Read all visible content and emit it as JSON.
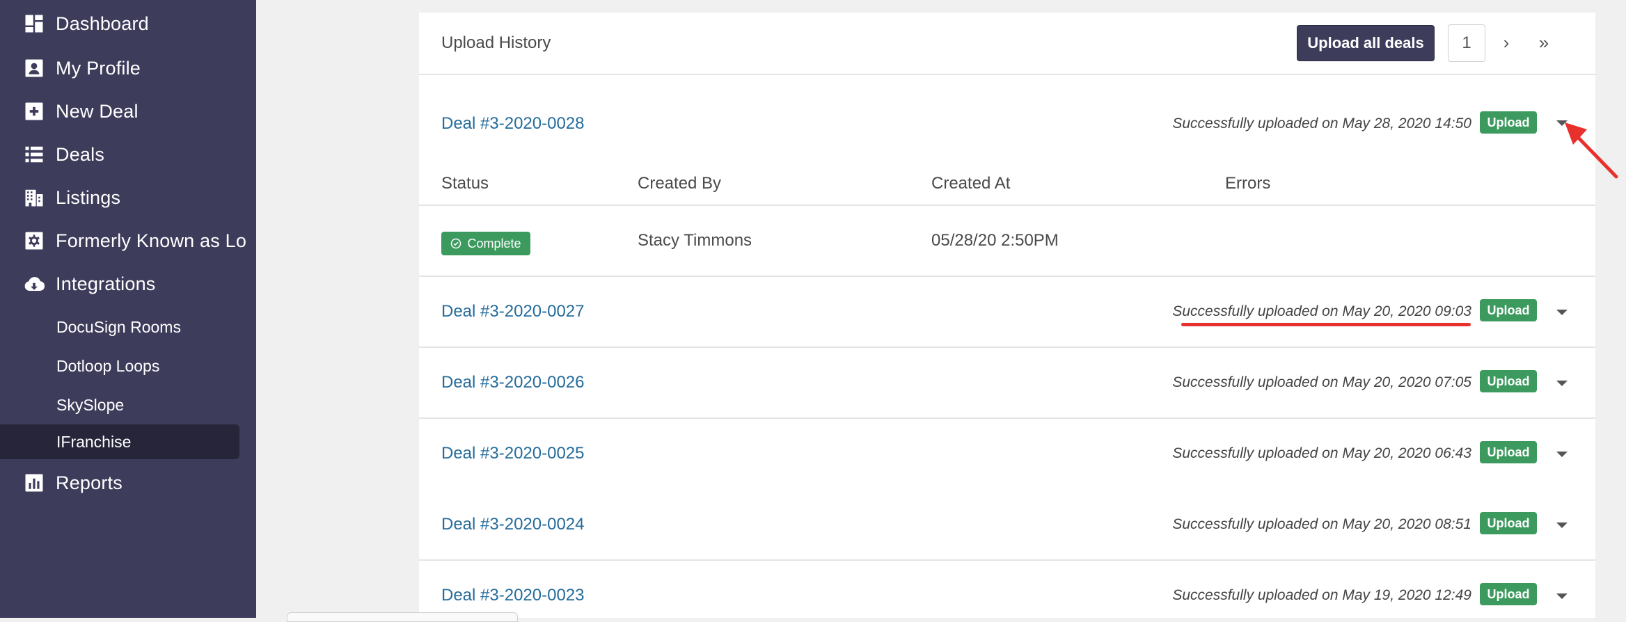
{
  "sidebar": {
    "items": [
      {
        "label": "Dashboard",
        "icon": "dashboard-icon"
      },
      {
        "label": "My Profile",
        "icon": "profile-icon"
      },
      {
        "label": "New Deal",
        "icon": "plus-square-icon"
      },
      {
        "label": "Deals",
        "icon": "list-icon"
      },
      {
        "label": "Listings",
        "icon": "building-icon"
      },
      {
        "label": "Formerly Known as Lo",
        "icon": "gear-icon"
      },
      {
        "label": "Integrations",
        "icon": "cloud-download-icon"
      },
      {
        "label": "Reports",
        "icon": "bar-chart-icon"
      }
    ],
    "integrations": [
      {
        "label": "DocuSign Rooms"
      },
      {
        "label": "Dotloop Loops"
      },
      {
        "label": "SkySlope"
      },
      {
        "label": "IFranchise",
        "active": true
      }
    ]
  },
  "header": {
    "title": "Upload History",
    "upload_all_label": "Upload all deals",
    "page": "1",
    "next": "›",
    "last": "»"
  },
  "deals": [
    {
      "name": "Deal #3-2020-0028",
      "status": "Successfully uploaded on May 28, 2020 14:50",
      "badge": "Upload",
      "expanded": true
    },
    {
      "name": "Deal #3-2020-0027",
      "status": "Successfully uploaded on May 20, 2020 09:03",
      "badge": "Upload"
    },
    {
      "name": "Deal #3-2020-0026",
      "status": "Successfully uploaded on May 20, 2020 07:05",
      "badge": "Upload"
    },
    {
      "name": "Deal #3-2020-0025",
      "status": "Successfully uploaded on May 20, 2020 06:43",
      "badge": "Upload"
    },
    {
      "name": "Deal #3-2020-0024",
      "status": "Successfully uploaded on May 20, 2020 08:51",
      "badge": "Upload"
    },
    {
      "name": "Deal #3-2020-0023",
      "status": "Successfully uploaded on May 19, 2020 12:49",
      "badge": "Upload"
    }
  ],
  "detail": {
    "columns": [
      "Status",
      "Created By",
      "Created At",
      "Errors"
    ],
    "row": {
      "status": "Complete",
      "created_by": "Stacy Timmons",
      "created_at": "05/28/20 2:50PM",
      "errors": ""
    }
  },
  "colors": {
    "sidebar_bg": "#3e3c5b",
    "active_bg": "#26253a",
    "link": "#256c9b",
    "badge_green": "#3d9a5f",
    "annotation_red": "#e8312c"
  }
}
